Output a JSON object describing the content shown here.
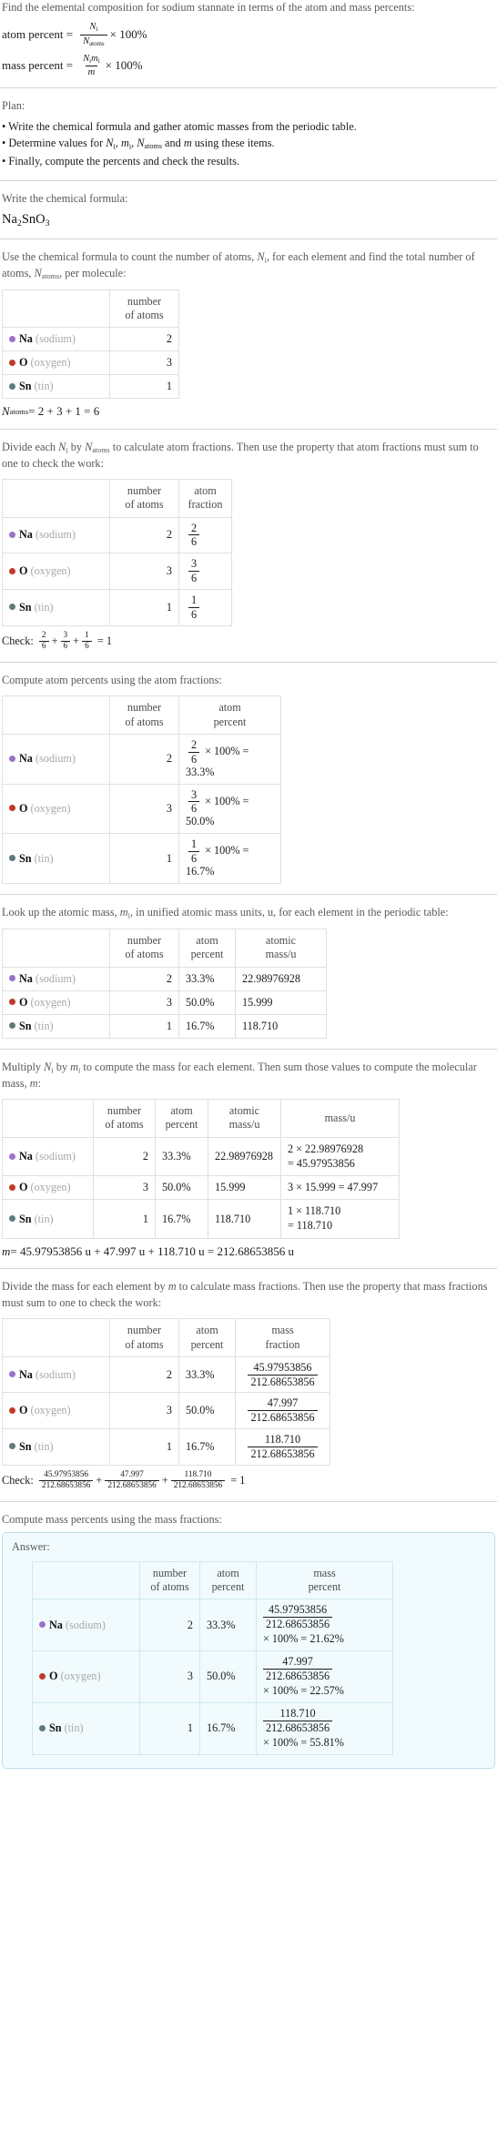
{
  "intro": {
    "question": "Find the elemental composition for sodium stannate in terms of the atom and mass percents:",
    "atom_percent_label": "atom percent =",
    "mass_percent_label": "mass percent =",
    "times_100": "× 100%",
    "atom_percent_num": "N",
    "atom_percent_num_sub": "i",
    "atom_percent_den": "N",
    "atom_percent_den_sub": "atoms",
    "mass_percent_num": "N",
    "mass_percent_num_sub": "i",
    "mass_percent_num2": "m",
    "mass_percent_num2_sub": "i",
    "mass_percent_den": "m"
  },
  "plan": {
    "heading": "Plan:",
    "items": [
      "• Write the chemical formula and gather atomic masses from the periodic table.",
      "• Determine values for N_i, m_i, N_atoms and m using these items.",
      "• Finally, compute the percents and check the results."
    ],
    "bullet1": "• Write the chemical formula and gather atomic masses from the periodic table.",
    "bullet2_pre": "• Determine values for ",
    "bullet2_mid": ", ",
    "bullet2_and": " and ",
    "bullet2_post": " using these items.",
    "bullet3": "• Finally, compute the percents and check the results."
  },
  "formula_section": {
    "prompt": "Write the chemical formula:",
    "formula_parts": [
      "Na",
      "2",
      "SnO",
      "3"
    ],
    "formula_plain": "Na2SnO3"
  },
  "count_section": {
    "prompt_line1": "Use the chemical formula to count the number of atoms, N_i, for each element",
    "prompt_line2": "and find the total number of atoms, N_atoms, per molecule:",
    "prompt_a": "Use the chemical formula to count the number of atoms, ",
    "prompt_b": ", for each element and find the total number of atoms, ",
    "prompt_c": ", per molecule:",
    "headers": [
      "",
      "number of atoms"
    ],
    "header_num_line1": "number",
    "header_num_line2": "of atoms",
    "total_line": "N_atoms = 2 + 3 + 1 = 6",
    "total_expr": " = 2 + 3 + 1 = 6"
  },
  "elements": [
    {
      "symbol": "Na",
      "name": "(sodium)",
      "color": "#9b72c9",
      "count": "2",
      "fraction_num": "2",
      "fraction_den": "6",
      "atom_percent": "33.3%",
      "atomic_mass": "22.98976928",
      "mass_expr_line1": "2 × 22.98976928",
      "mass_expr_line2": "= 45.97953856",
      "mass_value": "45.97953856",
      "mass_frac_num": "45.97953856",
      "mass_frac_den": "212.68653856",
      "mass_percent": "21.62%"
    },
    {
      "symbol": "O",
      "name": "(oxygen)",
      "color": "#c0392b",
      "count": "3",
      "fraction_num": "3",
      "fraction_den": "6",
      "atom_percent": "50.0%",
      "atomic_mass": "15.999",
      "mass_expr_line1": "3 × 15.999 = 47.997",
      "mass_expr_line2": "",
      "mass_value": "47.997",
      "mass_frac_num": "47.997",
      "mass_frac_den": "212.68653856",
      "mass_percent": "22.57%"
    },
    {
      "symbol": "Sn",
      "name": "(tin)",
      "color": "#5f7a7a",
      "count": "1",
      "fraction_num": "1",
      "fraction_den": "6",
      "atom_percent": "16.7%",
      "atomic_mass": "118.710",
      "mass_expr_line1": "1 × 118.710",
      "mass_expr_line2": "= 118.710",
      "mass_value": "118.710",
      "mass_frac_num": "118.710",
      "mass_frac_den": "212.68653856",
      "mass_percent": "55.81%"
    }
  ],
  "atom_fraction_section": {
    "prompt_a": "Divide each ",
    "prompt_b": " by ",
    "prompt_c": " to calculate atom fractions. Then use the property that atom fractions must sum to one to check the work:",
    "header_frac_line1": "atom",
    "header_frac_line2": "fraction",
    "check_label": "Check:",
    "check_plus": "+",
    "check_eq": "= 1"
  },
  "atom_percent_section": {
    "prompt": "Compute atom percents using the atom fractions:",
    "header_pct_line1": "atom",
    "header_pct_line2": "percent",
    "times": "× 100% ="
  },
  "atomic_mass_section": {
    "prompt_a": "Look up the atomic mass, ",
    "prompt_b": ", in unified atomic mass units, u, for each element in the periodic table:",
    "header_mass_line1": "atomic",
    "header_mass_line2": "mass/u"
  },
  "mass_section": {
    "prompt_a": "Multiply ",
    "prompt_b": " by ",
    "prompt_c": " to compute the mass for each element. Then sum those values to compute the molecular mass, ",
    "prompt_d": ":",
    "header_massu": "mass/u",
    "total_label": "m",
    "total_expr": " = 45.97953856 u + 47.997 u + 118.710 u = 212.68653856 u"
  },
  "mass_fraction_section": {
    "prompt_a": "Divide the mass for each element by ",
    "prompt_b": " to calculate mass fractions. Then use the property that mass fractions must sum to one to check the work:",
    "header_frac_line1": "mass",
    "header_frac_line2": "fraction",
    "check_label": "Check:",
    "check_plus": "+",
    "check_eq": "= 1"
  },
  "mass_percent_section": {
    "prompt": "Compute mass percents using the mass fractions:",
    "answer_label": "Answer:",
    "header_pct_line1": "mass",
    "header_pct_line2": "percent",
    "times_eq": "× 100% ="
  }
}
